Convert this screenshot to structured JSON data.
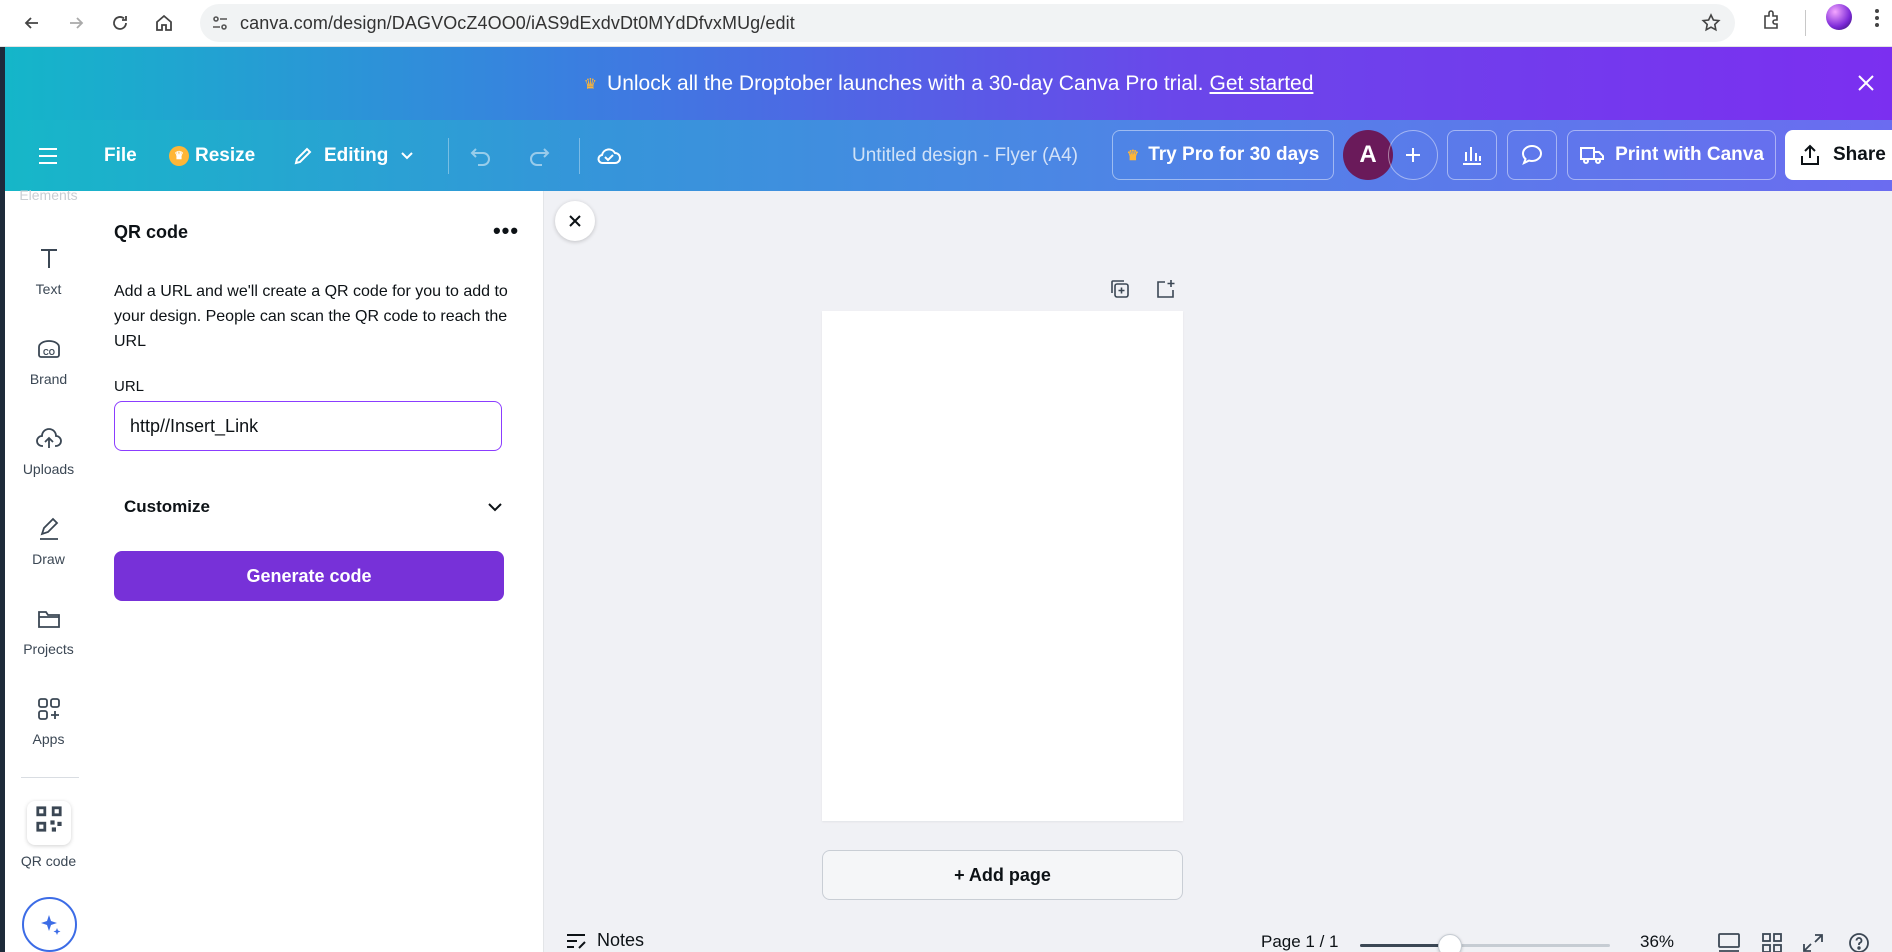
{
  "browser": {
    "url": "canva.com/design/DAGVOcZ4OO0/iAS9dExdvDt0MYdDfvxMUg/edit"
  },
  "promo": {
    "text": "Unlock all the Droptober launches with a 30-day Canva Pro trial.",
    "link": "Get started"
  },
  "header": {
    "file": "File",
    "resize": "Resize",
    "editing": "Editing",
    "doc_title": "Untitled design - Flyer (A4)",
    "try_pro": "Try Pro for 30 days",
    "avatar_initial": "A",
    "print": "Print with Canva",
    "share": "Share"
  },
  "rail": {
    "cut_label": "Elements",
    "items": [
      {
        "label": "Text",
        "icon": "text-icon"
      },
      {
        "label": "Brand",
        "icon": "brand-icon"
      },
      {
        "label": "Uploads",
        "icon": "upload-cloud-icon"
      },
      {
        "label": "Draw",
        "icon": "pen-icon"
      },
      {
        "label": "Projects",
        "icon": "folder-icon"
      },
      {
        "label": "Apps",
        "icon": "apps-icon"
      },
      {
        "label": "QR code",
        "icon": "qr-code-icon"
      }
    ]
  },
  "panel": {
    "title": "QR code",
    "description": "Add a URL and we'll create a QR code for you to add to your design. People can scan the QR code to reach the URL",
    "url_label": "URL",
    "url_value": "http//Insert_Link",
    "customize": "Customize",
    "generate": "Generate code"
  },
  "canvas": {
    "add_page": "+ Add page"
  },
  "bottom": {
    "notes": "Notes",
    "page": "Page 1 / 1",
    "zoom": "36%",
    "zoom_fraction": 0.36
  },
  "colors": {
    "accent_purple": "#7731d8",
    "input_border": "#8b3dff",
    "avatar": "#6a1a5a"
  }
}
